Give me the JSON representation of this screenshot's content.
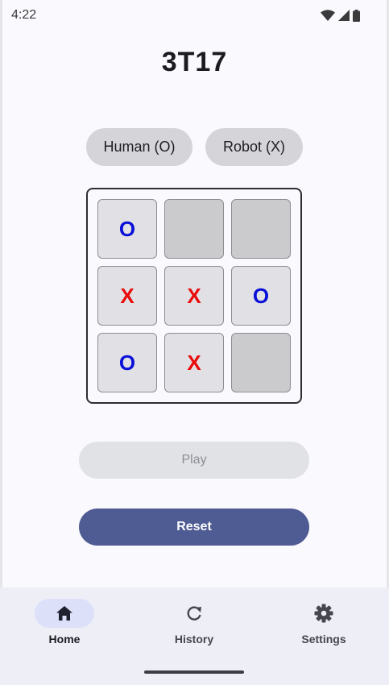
{
  "status_bar": {
    "time": "4:22"
  },
  "app": {
    "title": "3T17"
  },
  "players": {
    "human_label": "Human (O)",
    "robot_label": "Robot (X)"
  },
  "board": {
    "cells": [
      "O",
      "",
      "",
      "X",
      "X",
      "O",
      "O",
      "X",
      ""
    ]
  },
  "buttons": {
    "play_label": "Play",
    "reset_label": "Reset"
  },
  "nav": {
    "items": [
      {
        "label": "Home",
        "icon": "home-icon",
        "active": true
      },
      {
        "label": "History",
        "icon": "refresh-icon",
        "active": false
      },
      {
        "label": "Settings",
        "icon": "gear-icon",
        "active": false
      }
    ]
  },
  "colors": {
    "o_mark": "#0b10d8",
    "x_mark": "#ea0b0b",
    "primary": "#4f5b93",
    "nav_active": "#dde0f9"
  }
}
